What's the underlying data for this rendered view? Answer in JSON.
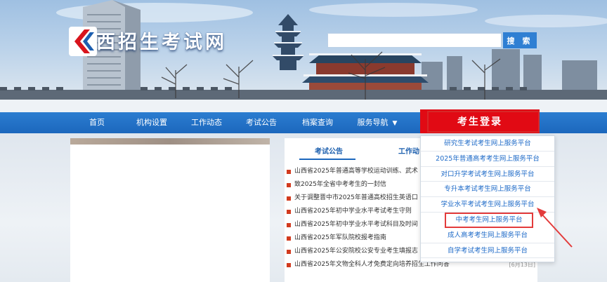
{
  "header": {
    "site_title": "山西招生考试网",
    "search_placeholder": "",
    "search_button": "搜 索"
  },
  "nav": {
    "items": [
      "首页",
      "机构设置",
      "工作动态",
      "考试公告",
      "档案查询",
      "服务导航"
    ],
    "login_button": "考生登录"
  },
  "tabs": [
    "考试公告",
    "工作动"
  ],
  "news": [
    {
      "title": "山西省2025年普通高等学校运动训练、武术",
      "date": ""
    },
    {
      "title": "致2025年全省中考考生的一封信",
      "date": ""
    },
    {
      "title": "关于调整晋中市2025年普通高校招生英语口",
      "date": ""
    },
    {
      "title": "山西省2025年初中学业水平考试考生守则",
      "date": ""
    },
    {
      "title": "山西省2025年初中学业水平考试科目及时间",
      "date": ""
    },
    {
      "title": "山西省2025年军队院校报考指南",
      "date": ""
    },
    {
      "title": "山西省2025年公安院校公安专业考生填报志",
      "date": ""
    },
    {
      "title": "山西省2025年文物全科人才免费定向培养招生工作问答",
      "date": "[6月13日]"
    }
  ],
  "dropdown": {
    "items": [
      "研究生考试考生网上服务平台",
      "2025年普通高考考生网上服务平台",
      "对口升学考试考生网上服务平台",
      "专升本考试考生网上服务平台",
      "学业水平考试考生网上服务平台",
      "中考考生网上服务平台",
      "成人高考考生网上服务平台",
      "自学考试考生网上服务平台"
    ],
    "highlighted_index": 5
  },
  "colors": {
    "nav_blue": "#1c67bd",
    "login_red": "#e10a14",
    "link_blue": "#1f6bc8",
    "annotation_red": "#e33b3b"
  }
}
